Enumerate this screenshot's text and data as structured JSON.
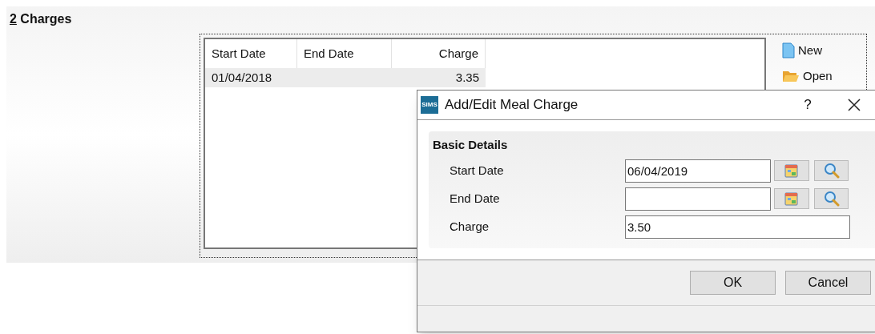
{
  "section": {
    "hotkey": "2",
    "title": "Charges"
  },
  "table": {
    "columns": [
      "Start Date",
      "End Date",
      "Charge"
    ],
    "rows": [
      {
        "start_date": "01/04/2018",
        "charge": "3.35",
        "selected": true
      }
    ]
  },
  "actions": [
    {
      "kind": "new",
      "label": "New"
    },
    {
      "kind": "open",
      "label": "Open"
    }
  ],
  "dialog": {
    "logo": "SIMS",
    "title": "Add/Edit Meal Charge",
    "help": "?",
    "group_title": "Basic Details",
    "fields": [
      {
        "kind": "date",
        "label": "Start Date",
        "value": "06/04/2019"
      },
      {
        "kind": "date",
        "label": "End Date"
      },
      {
        "kind": "text",
        "label": "Charge",
        "value": "3.50"
      }
    ],
    "buttons": [
      "OK",
      "Cancel"
    ]
  }
}
